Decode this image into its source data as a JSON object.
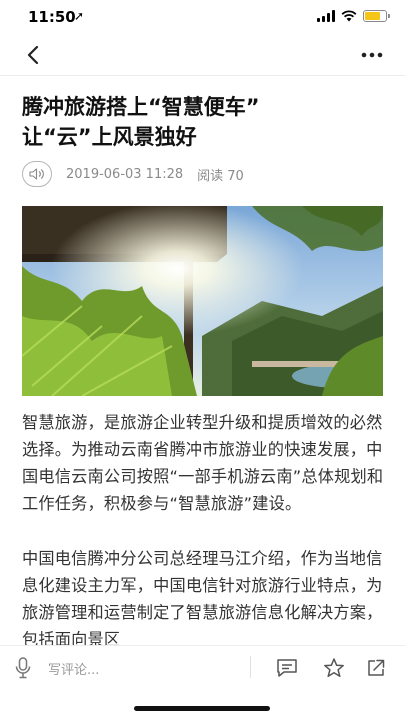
{
  "status_bar": {
    "time": "11:50",
    "location_glyph": "➚",
    "battery_level": 0.75,
    "battery_color": "#f5c518"
  },
  "nav": {
    "back_icon": "chevron-left-icon",
    "more_icon": "more-dots-icon"
  },
  "article": {
    "title_line1": "腾冲旅游搭上“智慧便车”",
    "title_line2": "让“云”上风景独好",
    "date": "2019-06-03 11:28",
    "reads": "阅读 70",
    "speaker_icon": "speaker-icon",
    "paragraphs": [
      "智慧旅游，是旅游企业转型升级和提质增效的必然选择。为推动云南省腾冲市旅游业的快速发展，中国电信云南公司按照“一部手机游云南”总体规划和工作任务，积极参与“智慧旅游”建设。",
      "中国电信腾冲分公司总经理马江介绍，作为当地信息化建设主力军，中国电信针对旅游行业特点，为旅游管理和运营制定了智慧旅游信息化解决方案，包括面向景区"
    ]
  },
  "bottom_bar": {
    "comment_placeholder": "写评论...",
    "icons": [
      "mic-icon",
      "comment-icon",
      "star-icon",
      "share-icon"
    ]
  }
}
